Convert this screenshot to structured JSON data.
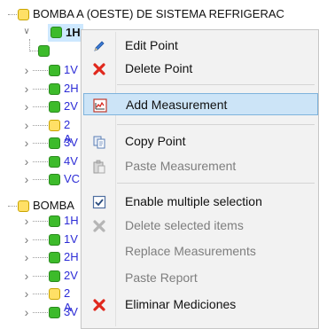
{
  "tree": {
    "root1_label": "BOMBA  A (OESTE) DE SISTEMA REFRIGERAC",
    "child_selected_label": "1H",
    "children_1": [
      "1V",
      "2H",
      "2V",
      "2 A",
      "3V",
      "4V",
      "VC"
    ],
    "root2_label": "BOMBA",
    "children_2": [
      "1H",
      "1V",
      "2H",
      "2V",
      "2 A",
      "3V"
    ]
  },
  "menu": {
    "items": [
      {
        "label": "Edit Point",
        "icon": "pencil-icon",
        "enabled": true
      },
      {
        "label": "Delete Point",
        "icon": "red-x-icon",
        "enabled": true
      },
      {
        "label": "Add Measurement",
        "icon": "measurement-chart-icon",
        "enabled": true,
        "highlighted": true
      },
      {
        "label": "Copy Point",
        "icon": "copy-icon",
        "enabled": true
      },
      {
        "label": "Paste Measurement",
        "icon": "paste-icon",
        "enabled": false
      },
      {
        "label": "Enable multiple selection",
        "icon": "checkbox-checked-icon",
        "enabled": true
      },
      {
        "label": "Delete selected items",
        "icon": "grey-x-icon",
        "enabled": false
      },
      {
        "label": "Replace Measurements",
        "icon": "",
        "enabled": false
      },
      {
        "label": "Paste Report",
        "icon": "",
        "enabled": false
      },
      {
        "label": "Eliminar Mediciones",
        "icon": "red-x-icon",
        "enabled": true
      }
    ]
  },
  "colors": {
    "node_yellow": "#ffe066",
    "node_green": "#3dbb2b",
    "link_blue": "#2c2cd6",
    "menu_highlight": "#cce4f7",
    "danger_red": "#e0281d"
  }
}
